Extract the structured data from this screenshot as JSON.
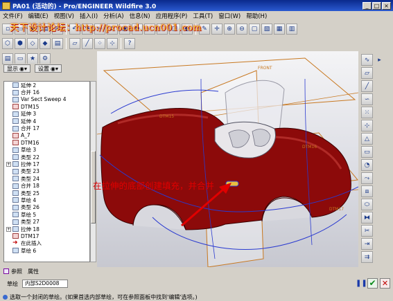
{
  "window": {
    "title": "PA01 (活动的) - Pro/ENGINEER Wildfire 3.0",
    "controls": [
      "_",
      "□",
      "×"
    ]
  },
  "menu": [
    "文件(F)",
    "编辑(E)",
    "视图(V)",
    "插入(I)",
    "分析(A)",
    "信息(N)",
    "应用程序(P)",
    "工具(T)",
    "窗口(W)",
    "帮助(H)"
  ],
  "watermark": "天下设计论坛：http://procad.ucn001.com",
  "panel": {
    "show_label": "显示",
    "settings_label": "设置"
  },
  "tree": [
    {
      "label": "延伸 2",
      "expand": false,
      "icon": "extend-icon"
    },
    {
      "label": "合并 16",
      "expand": false,
      "icon": "merge-icon"
    },
    {
      "label": "Var Sect Sweep 4",
      "expand": false,
      "icon": "sweep-icon"
    },
    {
      "label": "DTM15",
      "expand": false,
      "icon": "datum-plane-icon"
    },
    {
      "label": "延伸 3",
      "expand": false,
      "icon": "extend-icon"
    },
    {
      "label": "延伸 4",
      "expand": false,
      "icon": "extend-icon"
    },
    {
      "label": "合并 17",
      "expand": false,
      "icon": "merge-icon"
    },
    {
      "label": "A_7",
      "expand": false,
      "icon": "axis-icon"
    },
    {
      "label": "DTM16",
      "expand": false,
      "icon": "datum-plane-icon"
    },
    {
      "label": "草绘 3",
      "expand": false,
      "icon": "sketch-icon"
    },
    {
      "label": "类型 22",
      "expand": false,
      "icon": "surface-icon"
    },
    {
      "label": "拉伸 17",
      "expand": true,
      "icon": "extrude-icon"
    },
    {
      "label": "类型 23",
      "expand": false,
      "icon": "surface-icon"
    },
    {
      "label": "类型 24",
      "expand": false,
      "icon": "surface-icon"
    },
    {
      "label": "合并 18",
      "expand": false,
      "icon": "merge-icon"
    },
    {
      "label": "类型 25",
      "expand": false,
      "icon": "surface-icon"
    },
    {
      "label": "草绘 4",
      "expand": false,
      "icon": "sketch-icon"
    },
    {
      "label": "类型 26",
      "expand": false,
      "icon": "surface-icon"
    },
    {
      "label": "草绘 5",
      "expand": false,
      "icon": "sketch-icon"
    },
    {
      "label": "类型 27",
      "expand": false,
      "icon": "surface-icon"
    },
    {
      "label": "拉伸 18",
      "expand": true,
      "icon": "extrude-icon"
    },
    {
      "label": "DTM17",
      "expand": false,
      "icon": "datum-plane-icon"
    },
    {
      "label": "在此插入",
      "expand": false,
      "icon": "insert-here-icon"
    },
    {
      "label": "草绘 6",
      "expand": false,
      "icon": "sketch-icon"
    }
  ],
  "viewport": {
    "labels": [
      "FRONT",
      "DTM15",
      "DTM16",
      "DTM17"
    ],
    "callout": "在拉伸的底部创建填充，并合并"
  },
  "bottom": {
    "tab_refs": "参照",
    "tab_props": "属性",
    "sketch_label": "草绘",
    "sketch_value": "内部S2D0008"
  },
  "status": "选取一个封闭的草绘。(如果首选内部草绘，可在参照面板中找到'编辑'选项。)",
  "colors": {
    "car_body": "#8c0a0a",
    "datum_plane": "#c87820",
    "sketch_curve": "#2a3ad0",
    "callout": "#e00000",
    "titlebar": "#0a2a8c"
  }
}
